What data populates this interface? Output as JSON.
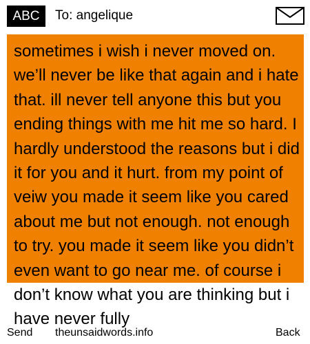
{
  "header": {
    "input_mode": "ABC",
    "recipient": "To: angelique",
    "envelope_icon": "envelope-icon"
  },
  "message": {
    "text": "sometimes i wish i never moved on. we’ll never be like that again and i hate that. ill never tell anyone this but you ending things with me hit me so hard. I hardly understood the reasons but i did it for you and it hurt. from my point of veiw you made it seem like you cared about me but not enough. not enough to try. you made it seem like you didn’t even want to go near me. of course i don’t know what you are thinking but i have never fully",
    "background_color": "#f08000"
  },
  "softkeys": {
    "left": "Send",
    "right": "Back"
  },
  "watermark": "theunsaidwords.info"
}
